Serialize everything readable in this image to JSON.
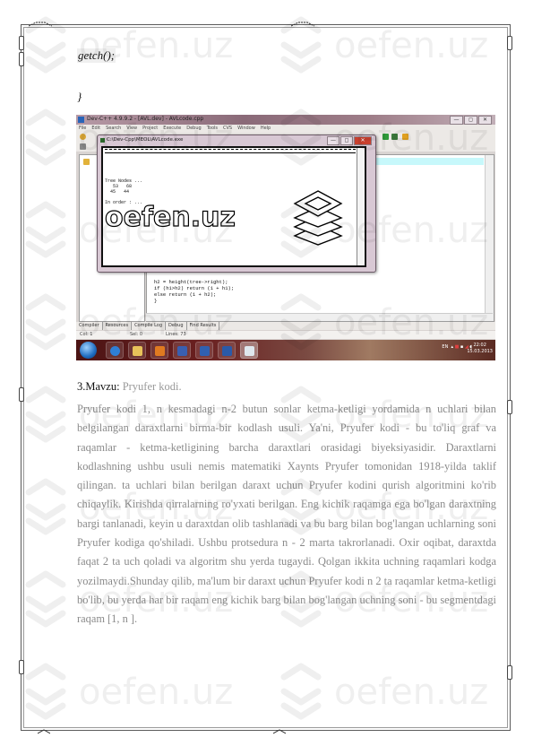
{
  "code": {
    "getch_line": "getch();",
    "closing_brace": "}"
  },
  "screenshot": {
    "window_title": "Dev-C++ 4.9.9.2 - [AVL.dev] - AVLcode.cpp",
    "menu": [
      "File",
      "Edit",
      "Search",
      "View",
      "Project",
      "Execute",
      "Debug",
      "Tools",
      "CVS",
      "Window",
      "Help"
    ],
    "window_buttons": [
      "—",
      "◻",
      "✕"
    ],
    "popup": {
      "title": "C:\\Dev-Cpp\\MEOL\\AVLcode.exe",
      "buttons": [
        "—",
        "◻",
        "✕"
      ],
      "console_text": "Tree Nodes ...\n   53   68\n  45   44\n\nIn order : ...",
      "watermark": "oefen.uz"
    },
    "editor_code": [
      "h2 = height(tree->right);",
      "if (h1>h2) return (1 + h1);",
      "else return (1 + h2);",
      "}"
    ],
    "bottom_tabs": [
      "Compiler",
      "Resources",
      "Compile Log",
      "Debug",
      "Find Results"
    ],
    "status": [
      "Col: 1",
      "Sel: 0",
      "Lines: 73"
    ],
    "taskbar": {
      "apps": [
        "start",
        "internet-explorer",
        "file-explorer",
        "media-player",
        "save",
        "dev-cpp",
        "word",
        "console"
      ],
      "language": "EN",
      "time": "22:02",
      "date": "15.03.2013"
    }
  },
  "section": {
    "label": "3.Mavzu:",
    "title": "Pryufer kodi."
  },
  "paragraph": "Pryufer kodi  1, n  kesmadagi n-2 butun sonlar ketma-ketligi yordamida n uchlari bilan   belgilangan daraxtlarni  birma-bir  kodlash  usuli.  Ya'ni,  Pryufer  kodi  -  bu to'liq    graf    va    raqamlar    -   ketma-ketligining    barcha    daraxtlari    orasidagi biyeksiyasidir.   Daraxtlarni  kodlashning  ushbu  usuli  nemis  matematiki  Xaynts Pryufer  tomonidan  1918-yilda  taklif  qilingan.   ta  uchlari  bilan  berilgan  daraxt uchun  Pryufer  kodini  qurish  algoritmini  ko'rib  chiqaylik.    Kirishda  qirralarning ro'yxati  berilgan.  Eng  kichik  raqamga  ega  bo'lgan  daraxtning  bargi    tanlanadi, keyin  u  daraxtdan  olib  tashlanadi  va  bu  barg  bilan  bog'langan  uchlarning  soni Pryufer kodiga qo'shiladi. Ushbu protsedura n - 2 marta takrorlanadi. Oxir oqibat, daraxtda  faqat  2  ta  uch  qoladi  va  algoritm  shu  yerda  tugaydi.  Qolgan  ikkita uchning  raqamlari  kodga  yozilmaydi.Shunday  qilib,  ma'lum  bir  daraxt  uchun Pryufer kodi n    2 ta raqamlar ketma-ketligi bo'lib, bu yerda har bir raqam  eng kichik barg bilan bog'langan uchning soni - bu segmentdagi raqam [1, n ].",
  "watermark": {
    "text": "oefen.uz",
    "icon": "stacked-layers-icon"
  },
  "colors": {
    "body_text": "#8a8a8a",
    "heading_text": "#111111",
    "taskbar": "#6a2020",
    "editor_highlight": "#c7f8fb"
  }
}
